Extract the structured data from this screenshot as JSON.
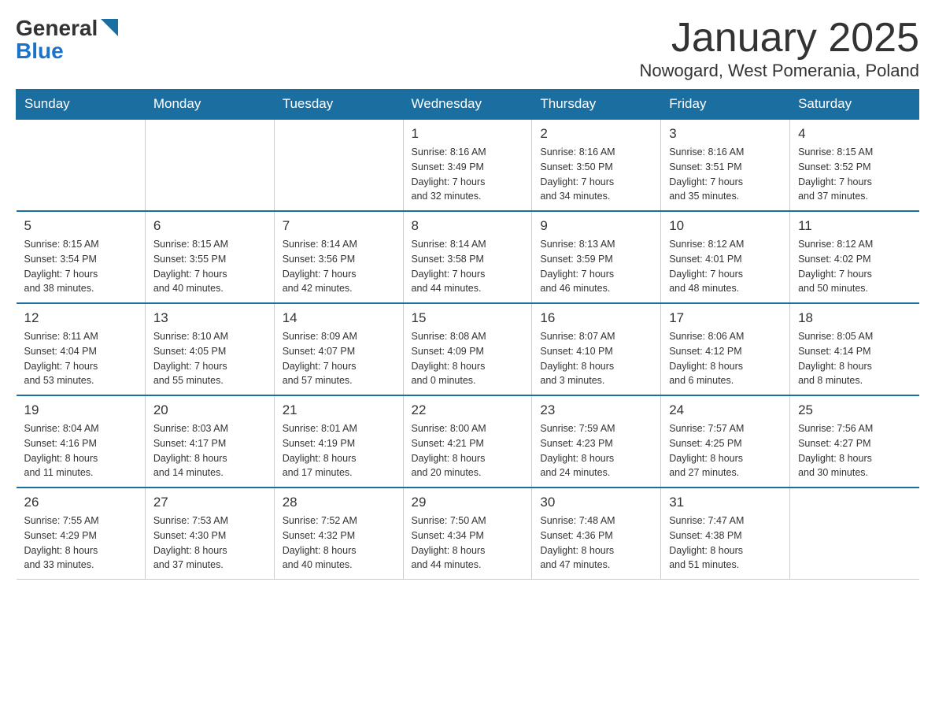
{
  "logo": {
    "general": "General",
    "blue": "Blue"
  },
  "title": "January 2025",
  "location": "Nowogard, West Pomerania, Poland",
  "days_of_week": [
    "Sunday",
    "Monday",
    "Tuesday",
    "Wednesday",
    "Thursday",
    "Friday",
    "Saturday"
  ],
  "weeks": [
    [
      {
        "day": "",
        "info": ""
      },
      {
        "day": "",
        "info": ""
      },
      {
        "day": "",
        "info": ""
      },
      {
        "day": "1",
        "info": "Sunrise: 8:16 AM\nSunset: 3:49 PM\nDaylight: 7 hours\nand 32 minutes."
      },
      {
        "day": "2",
        "info": "Sunrise: 8:16 AM\nSunset: 3:50 PM\nDaylight: 7 hours\nand 34 minutes."
      },
      {
        "day": "3",
        "info": "Sunrise: 8:16 AM\nSunset: 3:51 PM\nDaylight: 7 hours\nand 35 minutes."
      },
      {
        "day": "4",
        "info": "Sunrise: 8:15 AM\nSunset: 3:52 PM\nDaylight: 7 hours\nand 37 minutes."
      }
    ],
    [
      {
        "day": "5",
        "info": "Sunrise: 8:15 AM\nSunset: 3:54 PM\nDaylight: 7 hours\nand 38 minutes."
      },
      {
        "day": "6",
        "info": "Sunrise: 8:15 AM\nSunset: 3:55 PM\nDaylight: 7 hours\nand 40 minutes."
      },
      {
        "day": "7",
        "info": "Sunrise: 8:14 AM\nSunset: 3:56 PM\nDaylight: 7 hours\nand 42 minutes."
      },
      {
        "day": "8",
        "info": "Sunrise: 8:14 AM\nSunset: 3:58 PM\nDaylight: 7 hours\nand 44 minutes."
      },
      {
        "day": "9",
        "info": "Sunrise: 8:13 AM\nSunset: 3:59 PM\nDaylight: 7 hours\nand 46 minutes."
      },
      {
        "day": "10",
        "info": "Sunrise: 8:12 AM\nSunset: 4:01 PM\nDaylight: 7 hours\nand 48 minutes."
      },
      {
        "day": "11",
        "info": "Sunrise: 8:12 AM\nSunset: 4:02 PM\nDaylight: 7 hours\nand 50 minutes."
      }
    ],
    [
      {
        "day": "12",
        "info": "Sunrise: 8:11 AM\nSunset: 4:04 PM\nDaylight: 7 hours\nand 53 minutes."
      },
      {
        "day": "13",
        "info": "Sunrise: 8:10 AM\nSunset: 4:05 PM\nDaylight: 7 hours\nand 55 minutes."
      },
      {
        "day": "14",
        "info": "Sunrise: 8:09 AM\nSunset: 4:07 PM\nDaylight: 7 hours\nand 57 minutes."
      },
      {
        "day": "15",
        "info": "Sunrise: 8:08 AM\nSunset: 4:09 PM\nDaylight: 8 hours\nand 0 minutes."
      },
      {
        "day": "16",
        "info": "Sunrise: 8:07 AM\nSunset: 4:10 PM\nDaylight: 8 hours\nand 3 minutes."
      },
      {
        "day": "17",
        "info": "Sunrise: 8:06 AM\nSunset: 4:12 PM\nDaylight: 8 hours\nand 6 minutes."
      },
      {
        "day": "18",
        "info": "Sunrise: 8:05 AM\nSunset: 4:14 PM\nDaylight: 8 hours\nand 8 minutes."
      }
    ],
    [
      {
        "day": "19",
        "info": "Sunrise: 8:04 AM\nSunset: 4:16 PM\nDaylight: 8 hours\nand 11 minutes."
      },
      {
        "day": "20",
        "info": "Sunrise: 8:03 AM\nSunset: 4:17 PM\nDaylight: 8 hours\nand 14 minutes."
      },
      {
        "day": "21",
        "info": "Sunrise: 8:01 AM\nSunset: 4:19 PM\nDaylight: 8 hours\nand 17 minutes."
      },
      {
        "day": "22",
        "info": "Sunrise: 8:00 AM\nSunset: 4:21 PM\nDaylight: 8 hours\nand 20 minutes."
      },
      {
        "day": "23",
        "info": "Sunrise: 7:59 AM\nSunset: 4:23 PM\nDaylight: 8 hours\nand 24 minutes."
      },
      {
        "day": "24",
        "info": "Sunrise: 7:57 AM\nSunset: 4:25 PM\nDaylight: 8 hours\nand 27 minutes."
      },
      {
        "day": "25",
        "info": "Sunrise: 7:56 AM\nSunset: 4:27 PM\nDaylight: 8 hours\nand 30 minutes."
      }
    ],
    [
      {
        "day": "26",
        "info": "Sunrise: 7:55 AM\nSunset: 4:29 PM\nDaylight: 8 hours\nand 33 minutes."
      },
      {
        "day": "27",
        "info": "Sunrise: 7:53 AM\nSunset: 4:30 PM\nDaylight: 8 hours\nand 37 minutes."
      },
      {
        "day": "28",
        "info": "Sunrise: 7:52 AM\nSunset: 4:32 PM\nDaylight: 8 hours\nand 40 minutes."
      },
      {
        "day": "29",
        "info": "Sunrise: 7:50 AM\nSunset: 4:34 PM\nDaylight: 8 hours\nand 44 minutes."
      },
      {
        "day": "30",
        "info": "Sunrise: 7:48 AM\nSunset: 4:36 PM\nDaylight: 8 hours\nand 47 minutes."
      },
      {
        "day": "31",
        "info": "Sunrise: 7:47 AM\nSunset: 4:38 PM\nDaylight: 8 hours\nand 51 minutes."
      },
      {
        "day": "",
        "info": ""
      }
    ]
  ]
}
